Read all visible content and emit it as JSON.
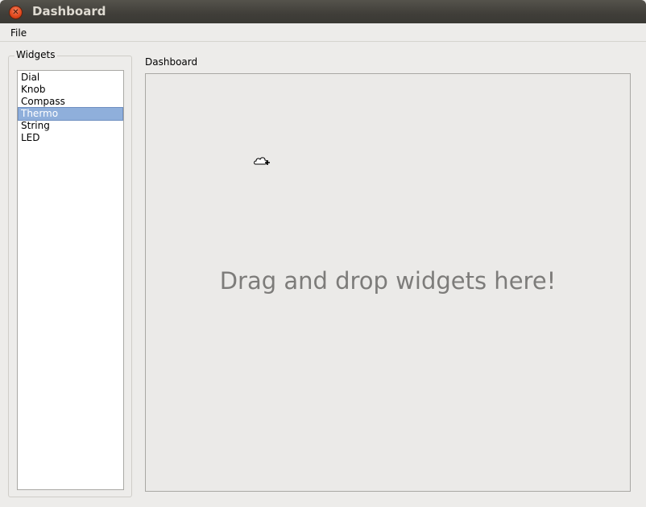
{
  "window": {
    "title": "Dashboard"
  },
  "menu": {
    "file": "File"
  },
  "widgets": {
    "group_title": "Widgets",
    "items": [
      "Dial",
      "Knob",
      "Compass",
      "Thermo",
      "String",
      "LED"
    ],
    "selected": "Thermo"
  },
  "dashboard": {
    "label": "Dashboard",
    "hint": "Drag and drop widgets here!"
  },
  "colors": {
    "selection": "#8fafdb",
    "close_button": "#e0461b"
  }
}
